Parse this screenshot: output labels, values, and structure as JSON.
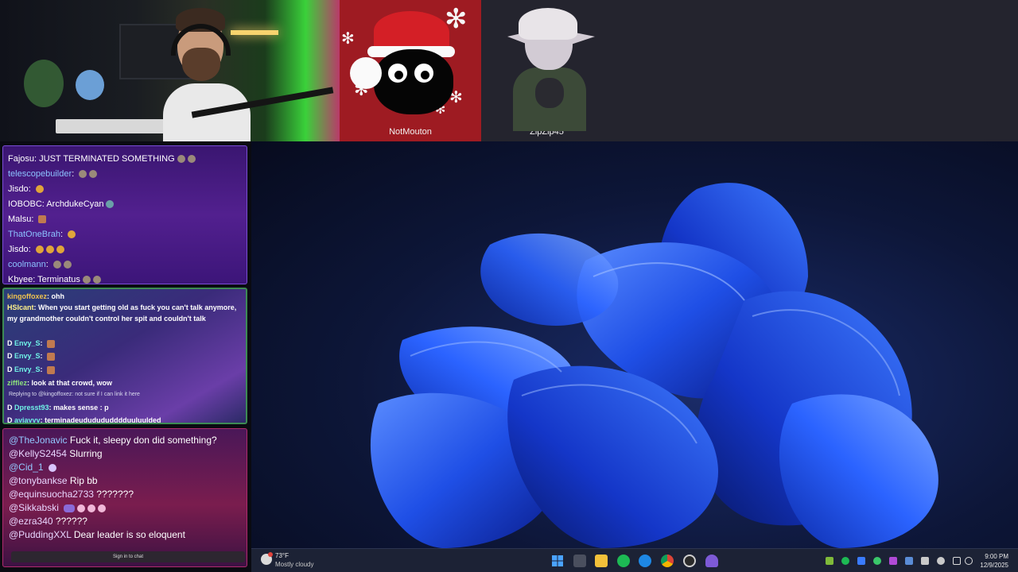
{
  "colors": {
    "accent": "#3563ff",
    "chat_blue_user": "#8cc2ff",
    "taskbar": "#1c2235"
  },
  "guests": [
    {
      "name": "NotMouton"
    },
    {
      "name": "ZipZip45"
    }
  ],
  "chat1": [
    {
      "user": "Fajosu",
      "sep": ":",
      "text": "JUST TERMINATED SOMETHING",
      "emote": "terminator-emote"
    },
    {
      "user": "telescopebuilder",
      "sep": ":",
      "text": "",
      "emote": "terminator-emote"
    },
    {
      "user": "Jisdo",
      "sep": ":",
      "text": "",
      "emote": "ring-emote"
    },
    {
      "user": "IOBOBC",
      "sep": ":",
      "text": "ArchdukeCyan",
      "emote": "small-emote"
    },
    {
      "user": "Malsu",
      "sep": ":",
      "text": "",
      "emote": "face-emote"
    },
    {
      "user": "ThatOneBrah",
      "sep": ":",
      "text": "",
      "emote": "ring-emote"
    },
    {
      "user": "Jisdo",
      "sep": ":",
      "text": "",
      "emote": "ring-emote-triple"
    },
    {
      "user": "coolmann",
      "sep": ":",
      "text": "",
      "emote": "terminator-emote"
    },
    {
      "user": "Kbyee",
      "sep": ":",
      "text": "Terminatus",
      "emote": "terminator-emote"
    }
  ],
  "chat2": [
    {
      "user": "kingoffoxez",
      "sep": ":",
      "text": "ohh"
    },
    {
      "user": "HSIcant",
      "sep": ":",
      "text": "When you start getting old as fuck you can't talk anymore, my grandmother couldn't control her spit and couldn't talk"
    },
    {
      "badge": "D",
      "user": "Envy_S",
      "sep": ":",
      "text": ""
    },
    {
      "badge": "D",
      "user": "Envy_S",
      "sep": ":",
      "text": ""
    },
    {
      "badge": "D",
      "user": "Envy_S",
      "sep": ":",
      "text": ""
    },
    {
      "user": "zifflez",
      "sep": ":",
      "text": "look at that crowd, wow"
    },
    {
      "reply": "Replying to @kingoffoxez: not sure if I can link it here"
    },
    {
      "badge": "D",
      "user": "Dpresst93",
      "sep": ":",
      "text": "makes sense : p"
    },
    {
      "badge": "D",
      "user": "ayjayyy",
      "sep": ":",
      "text": "terminadeududududddduuluulded"
    }
  ],
  "chat3": [
    {
      "user": "@TheJonavic",
      "text": "Fuck it, sleepy don did something?"
    },
    {
      "user": "@KellyS2454",
      "text": "Slurring"
    },
    {
      "user": "@Cid_1",
      "text": ""
    },
    {
      "user": "@tonybankse",
      "text": "Rip bb"
    },
    {
      "user": "@equinsuocha2733",
      "text": "???????"
    },
    {
      "user": "@Sikkabski",
      "text": ""
    },
    {
      "user": "@ezra340",
      "text": "??????"
    },
    {
      "user": "@PuddingXXL",
      "text": "Dear leader is so eloquent"
    }
  ],
  "chat3_signin": "Sign in to chat",
  "taskbar": {
    "weather_temp": "73°F",
    "weather_cond": "Mostly cloudy",
    "time": "9:00 PM",
    "date": "12/9/2025",
    "apps": [
      "windows-start-icon",
      "task-view-icon",
      "file-explorer-icon",
      "spotify-icon",
      "edge-icon",
      "chrome-icon",
      "obs-icon",
      "app-icon"
    ]
  }
}
